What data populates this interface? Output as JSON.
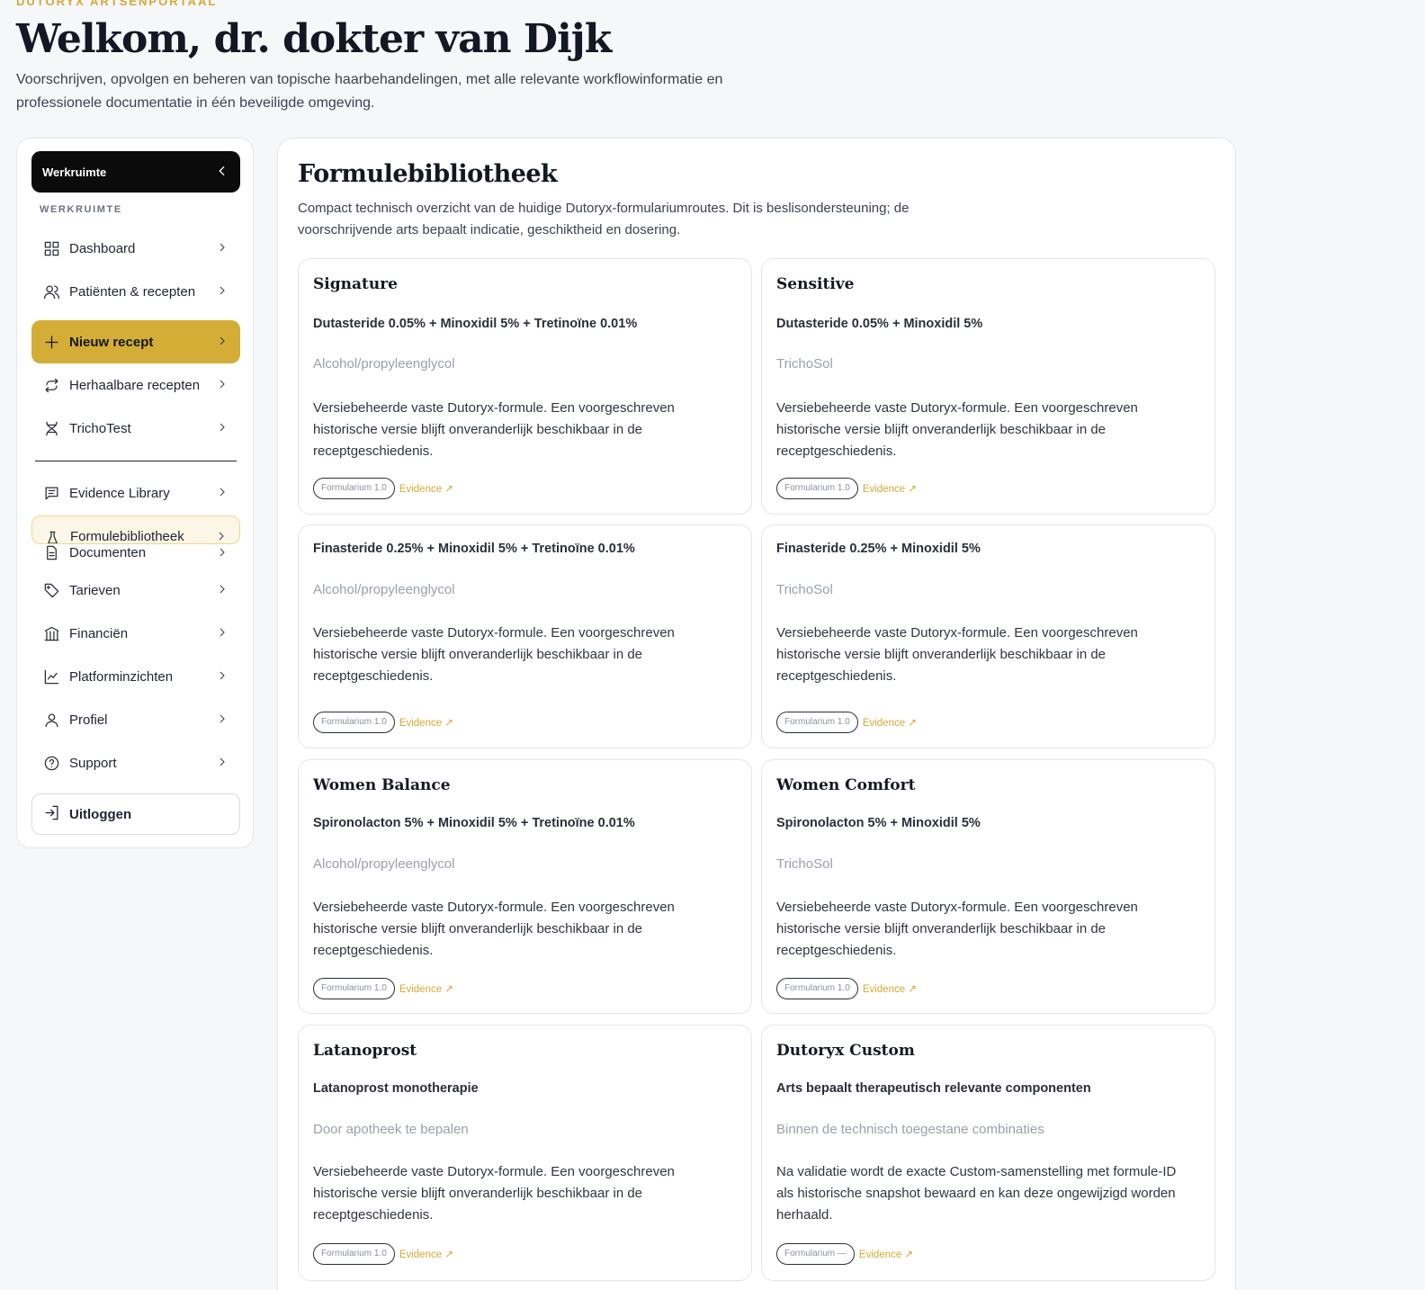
{
  "header": {
    "eyebrow": "DUTORYX ARTSENPORTAAL",
    "welcome": "Welkom, dr. dokter van Dijk",
    "intro": "Voorschrijven, opvolgen en beheren van topische haarbehandelingen, met alle relevante workflowinformatie en professionele documentatie in één beveiligde omgeving."
  },
  "sidebar": {
    "toggle_label": "Werkruimte",
    "section_heading": "WERKRUIMTE",
    "items": [
      {
        "label": "Dashboard",
        "icon": "grid-icon"
      },
      {
        "label": "Patiënten & recepten",
        "icon": "users-icon"
      },
      {
        "label": "Nieuw recept",
        "icon": "plus-icon"
      },
      {
        "label": "Herhaalbare recepten",
        "icon": "repeat-icon"
      },
      {
        "label": "TrichoTest",
        "icon": "dna-icon"
      },
      {
        "label": "Evidence Library",
        "icon": "message-square-icon"
      },
      {
        "label": "Formulebibliotheek",
        "icon": "flask-icon"
      },
      {
        "label": "Documenten",
        "icon": "document-icon"
      },
      {
        "label": "Tarieven",
        "icon": "tag-icon"
      },
      {
        "label": "Financiën",
        "icon": "bank-icon"
      },
      {
        "label": "Platforminzichten",
        "icon": "line-chart-icon"
      },
      {
        "label": "Profiel",
        "icon": "user-icon"
      },
      {
        "label": "Support",
        "icon": "help-circle-icon"
      }
    ],
    "logout_label": "Uitloggen",
    "accent_color": "#d4ad37"
  },
  "main": {
    "title": "Formulebibliotheek",
    "description": "Compact technisch overzicht van de huidige Dutoryx-formulariumroutes. Dit is beslisondersteuning; de voorschrijvende arts bepaalt indicatie, geschiktheid en dosering.",
    "evidence_label": "Evidence ↗",
    "cards": [
      {
        "name": "Signature",
        "composition": "Dutasteride 0.05% + Minoxidil 5% + Tretinoïne 0.01%",
        "vehicle": "Alcohol/propyleenglycol",
        "body": "Versiebeheerde vaste Dutoryx-formule. Een voorgeschreven historische versie blijft onveranderlijk beschikbaar in de receptgeschiedenis.",
        "badge": "Formularium 1.0"
      },
      {
        "name": "Sensitive",
        "composition": "Dutasteride 0.05% + Minoxidil 5%",
        "vehicle": "TrichoSol",
        "body": "Versiebeheerde vaste Dutoryx-formule. Een voorgeschreven historische versie blijft onveranderlijk beschikbaar in de receptgeschiedenis.",
        "badge": "Formularium 1.0"
      },
      {
        "name": "",
        "composition": "Finasteride 0.25% + Minoxidil 5% + Tretinoïne 0.01%",
        "vehicle": "Alcohol/propyleenglycol",
        "body": "Versiebeheerde vaste Dutoryx-formule. Een voorgeschreven historische versie blijft onveranderlijk beschikbaar in de receptgeschiedenis.",
        "badge": "Formularium 1.0"
      },
      {
        "name": "",
        "composition": "Finasteride 0.25% + Minoxidil 5%",
        "vehicle": "TrichoSol",
        "body": "Versiebeheerde vaste Dutoryx-formule. Een voorgeschreven historische versie blijft onveranderlijk beschikbaar in de receptgeschiedenis.",
        "badge": "Formularium 1.0"
      },
      {
        "name": "Women Balance",
        "composition": "Spironolacton 5% + Minoxidil 5% + Tretinoïne 0.01%",
        "vehicle": "Alcohol/propyleenglycol",
        "body": "Versiebeheerde vaste Dutoryx-formule. Een voorgeschreven historische versie blijft onveranderlijk beschikbaar in de receptgeschiedenis.",
        "badge": "Formularium 1.0"
      },
      {
        "name": "Women Comfort",
        "composition": "Spironolacton 5% + Minoxidil 5%",
        "vehicle": "TrichoSol",
        "body": "Versiebeheerde vaste Dutoryx-formule. Een voorgeschreven historische versie blijft onveranderlijk beschikbaar in de receptgeschiedenis.",
        "badge": "Formularium 1.0"
      },
      {
        "name": "Latanoprost",
        "composition": "Latanoprost monotherapie",
        "vehicle": "Door apotheek te bepalen",
        "body": "Versiebeheerde vaste Dutoryx-formule. Een voorgeschreven historische versie blijft onveranderlijk beschikbaar in de receptgeschiedenis.",
        "badge": "Formularium 1.0"
      },
      {
        "name": "Dutoryx Custom",
        "composition": "Arts bepaalt therapeutisch relevante componenten",
        "vehicle": "Binnen de technisch toegestane combinaties",
        "body": "Na validatie wordt de exacte Custom-samenstelling met formule-ID als historische snapshot bewaard en kan deze ongewijzigd worden herhaald.",
        "badge": "Formularium —"
      }
    ]
  }
}
